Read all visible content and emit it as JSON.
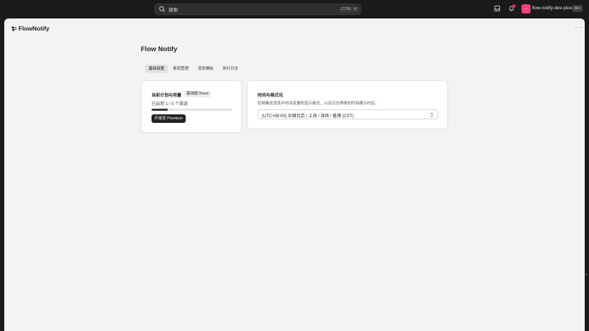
{
  "search": {
    "placeholder": "搜索",
    "shortcut_ctrl": "CTRL",
    "shortcut_key": "K"
  },
  "topbar": {
    "app_name": "flow-notify-dev-plus",
    "env_tag": "dev",
    "avatar_glyph": "⋯",
    "notification_badge": true
  },
  "brand": {
    "name": "FlowNotify"
  },
  "page": {
    "title": "Flow Notify"
  },
  "tabs": [
    {
      "label": "基础设置",
      "active": true
    },
    {
      "label": "渠道管理",
      "active": false
    },
    {
      "label": "消息模板",
      "active": false
    },
    {
      "label": "执行日志",
      "active": false
    }
  ],
  "plan": {
    "title": "当前计划与用量",
    "badge": "基础版 Basic",
    "usage_text": "已启用 1 / 5 个渠道",
    "usage_used": 1,
    "usage_total": 5,
    "upgrade_label": "升级至 Premium"
  },
  "time_format": {
    "title": "时间与格式化",
    "description": "控制推送消息中时间变量的显示格式，以及日志界面的时间展示时区。",
    "timezone_value": "(UTC+08:00) 中国北京 / 上海 / 深圳 / 香港 (CST)"
  },
  "colors": {
    "avatar_bg": "#ec407a",
    "badge_dot": "#e0245e",
    "progress_fill": "#3a3a3a",
    "primary_button": "#222222"
  }
}
